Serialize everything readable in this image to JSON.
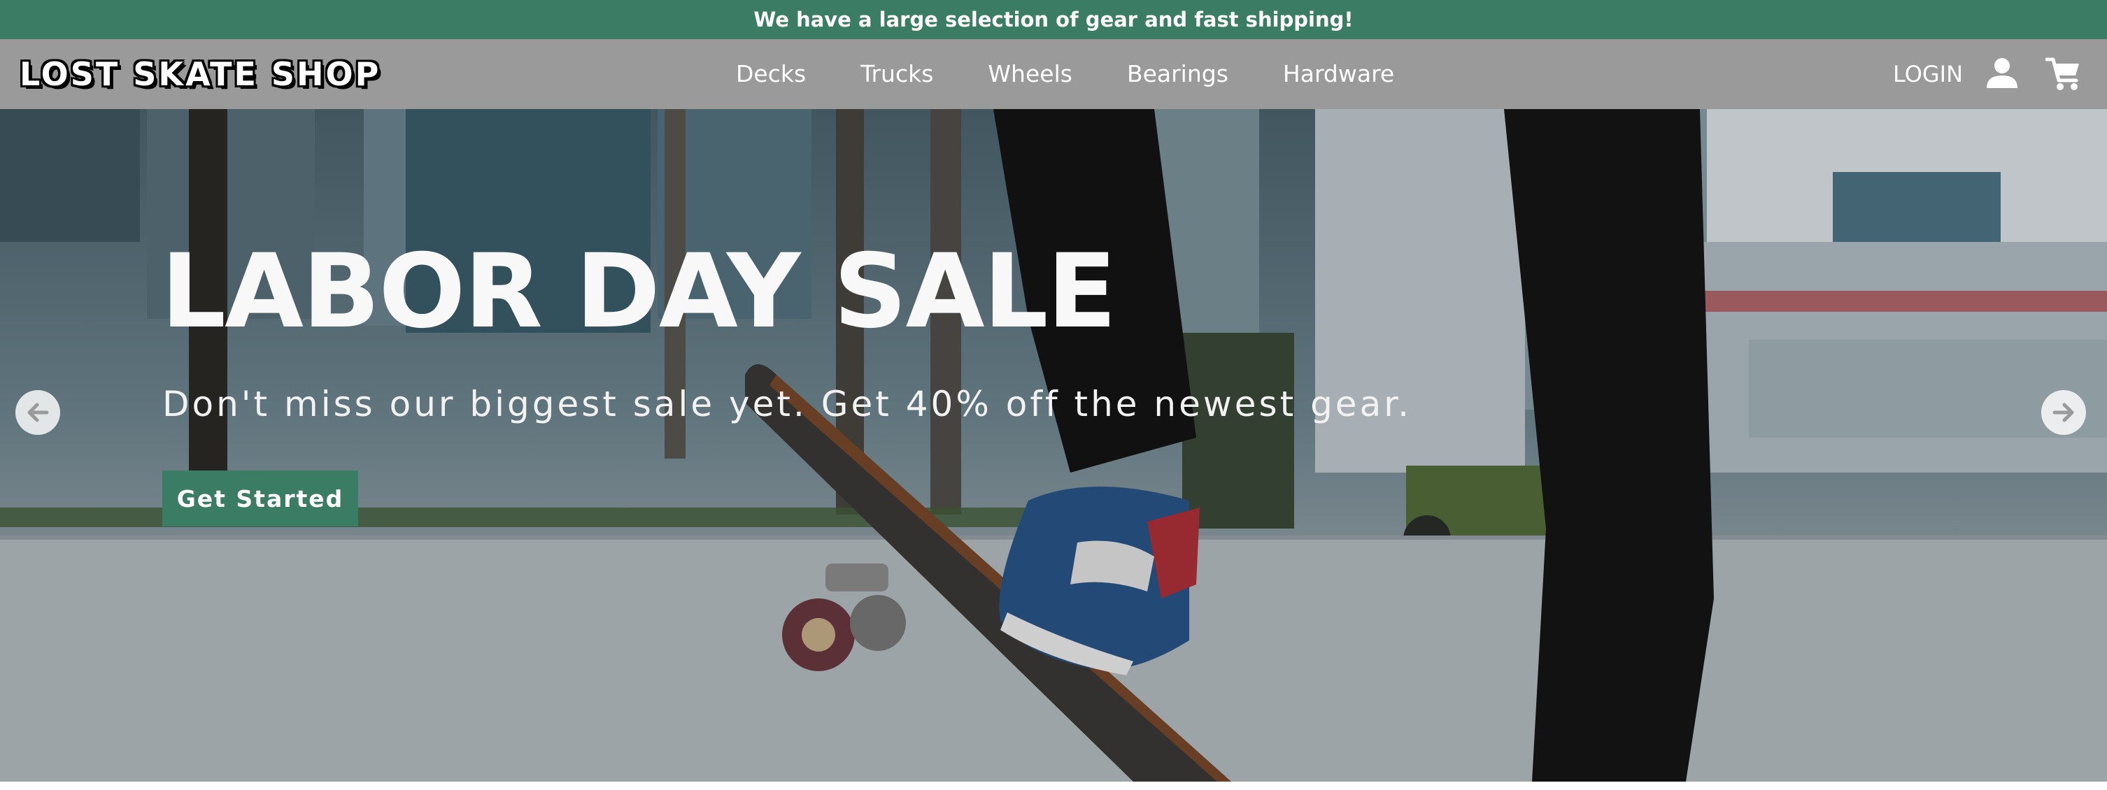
{
  "announcement": "We have a large selection of gear and fast shipping!",
  "brand": {
    "logo_text": "LOST SKATE SHOP"
  },
  "nav": {
    "items": [
      "Decks",
      "Trucks",
      "Wheels",
      "Bearings",
      "Hardware"
    ],
    "login": "LOGIN"
  },
  "hero": {
    "title": "LABOR DAY SALE",
    "subtitle": "Don't miss our biggest sale yet. Get 40% off the newest gear.",
    "cta": "Get Started"
  },
  "icons": {
    "account": "user-icon",
    "cart": "cart-icon",
    "prev": "arrow-left-icon",
    "next": "arrow-right-icon"
  },
  "colors": {
    "brand_green": "#3a7d64",
    "navbar_gray": "#9a9a9a"
  }
}
